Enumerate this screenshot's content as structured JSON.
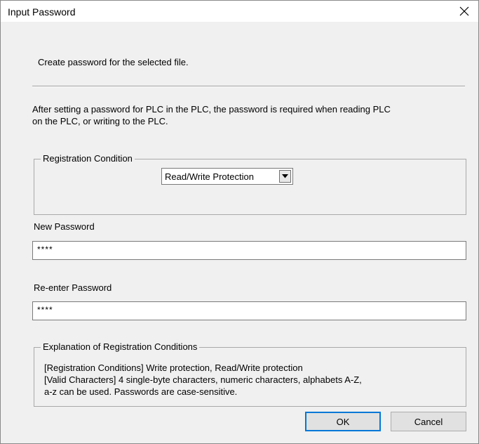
{
  "window": {
    "title": "Input Password",
    "close_glyph": "✕"
  },
  "intro": "Create password for the selected file.",
  "description_line1": "After setting a password for PLC in the PLC, the password is required when reading PLC",
  "description_line2": "on the PLC, or writing to the PLC.",
  "registration": {
    "group_label": "Registration Condition",
    "selected": "Read/Write Protection"
  },
  "new_password": {
    "label": "New Password",
    "value": "****"
  },
  "reenter_password": {
    "label": "Re-enter Password",
    "value": "****"
  },
  "explanation": {
    "group_label": "Explanation of Registration Conditions",
    "line1": "[Registration Conditions] Write protection, Read/Write protection",
    "line2": "[Valid Characters] 4 single-byte characters, numeric characters, alphabets A-Z,",
    "line3": "a-z can be used. Passwords are case-sensitive."
  },
  "buttons": {
    "ok": "OK",
    "cancel": "Cancel"
  },
  "colors": {
    "window_bg": "#f0f0f0",
    "titlebar_bg": "#ffffff",
    "default_button_border": "#0078d7"
  }
}
